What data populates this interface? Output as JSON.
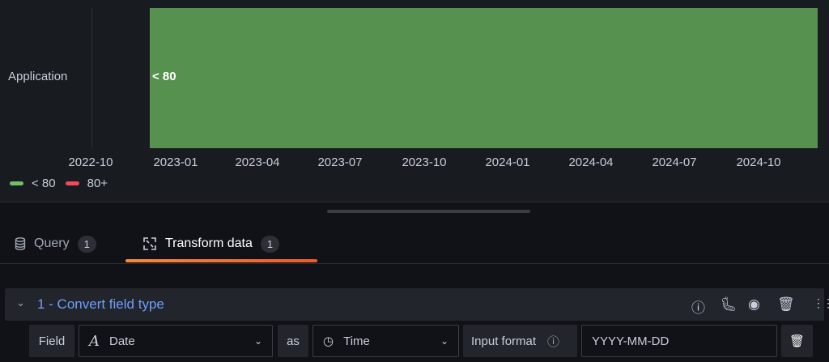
{
  "panel": {
    "row_label": "Application",
    "bar_label": "< 80",
    "bar_color": "#56914f",
    "x_ticks": [
      "2022-10",
      "2023-01",
      "2023-04",
      "2023-07",
      "2023-10",
      "2024-01",
      "2024-04",
      "2024-07",
      "2024-10"
    ],
    "legend": [
      {
        "label": "< 80",
        "color": "#73bf69"
      },
      {
        "label": "80+",
        "color": "#f2495c"
      }
    ]
  },
  "tabs": [
    {
      "label": "Query",
      "count": "1",
      "icon": "database-icon"
    },
    {
      "label": "Transform data",
      "count": "1",
      "icon": "transform-icon",
      "active": true
    }
  ],
  "transformation": {
    "title": "1 - Convert field type",
    "field_label": "Field",
    "field_value": "Date",
    "as_label": "as",
    "type_value": "Time",
    "input_format_label": "Input format",
    "input_format_value": "YYYY-MM-DD"
  }
}
